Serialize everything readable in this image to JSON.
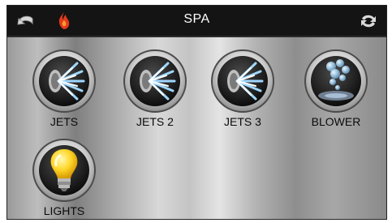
{
  "header": {
    "title": "SPA",
    "icons": [
      "back-arrow-icon",
      "flame-icon",
      "refresh-icon"
    ],
    "heat_icon_color": "#e23a1c"
  },
  "buttons": [
    {
      "label": "JETS",
      "icon": "jets-icon"
    },
    {
      "label": "JETS 2",
      "icon": "jets-icon"
    },
    {
      "label": "JETS 3",
      "icon": "jets-icon"
    },
    {
      "label": "BLOWER",
      "icon": "bubbles-icon"
    },
    {
      "label": "LIGHTS",
      "icon": "light-bulb-icon"
    }
  ]
}
